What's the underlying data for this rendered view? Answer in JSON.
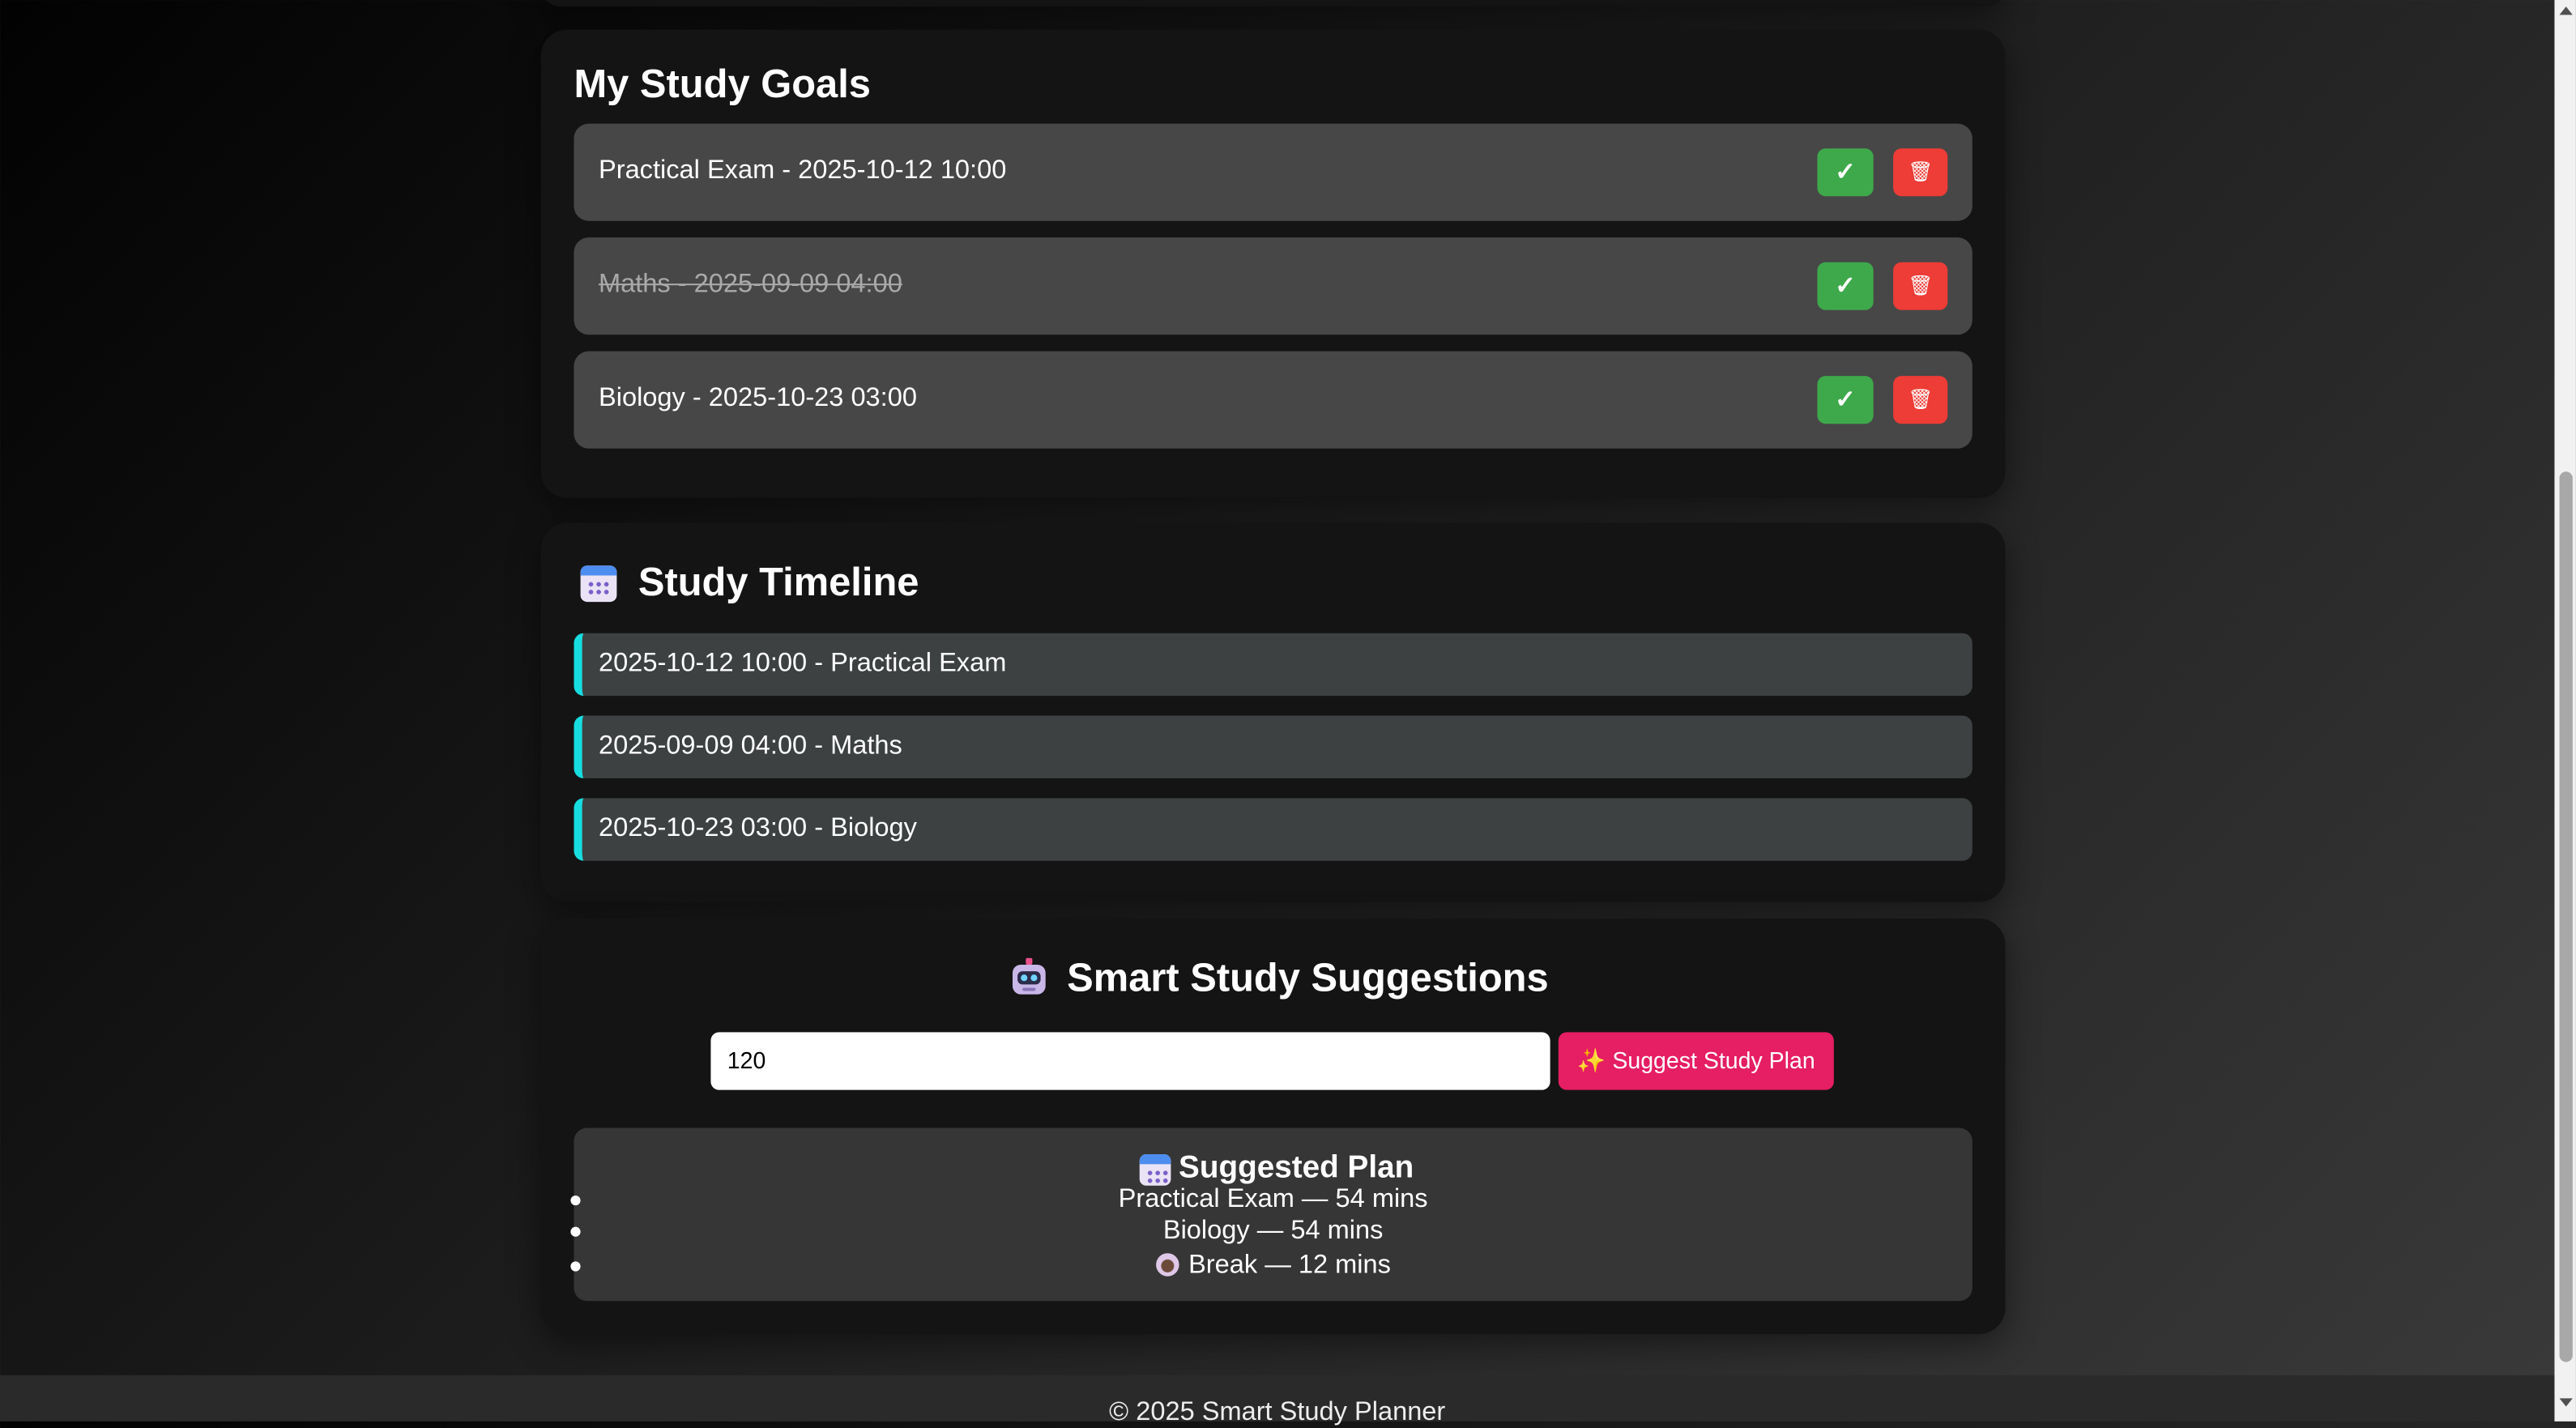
{
  "goals_section": {
    "title": "My Study Goals",
    "goals": [
      {
        "text": "Practical Exam - 2025-10-12 10:00",
        "completed": false
      },
      {
        "text": "Maths - 2025-09-09 04:00",
        "completed": true
      },
      {
        "text": "Biology - 2025-10-23 03:00",
        "completed": false
      }
    ],
    "done_button_label": "✓",
    "delete_button_label": "🗑"
  },
  "timeline_section": {
    "title": "Study Timeline",
    "icon": "calendar-icon",
    "items": [
      "2025-10-12 10:00 - Practical Exam",
      "2025-09-09 04:00 - Maths",
      "2025-10-23 03:00 - Biology"
    ],
    "accent_color": "#17dde0"
  },
  "suggestions_section": {
    "title": "Smart Study Suggestions",
    "icon": "robot-icon",
    "minutes_input_value": "120",
    "suggest_button_label": "✨ Suggest Study Plan",
    "plan": {
      "title": "Suggested Plan",
      "items": [
        "Practical Exam — 54 mins",
        "Biology — 54 mins",
        "Break — 12 mins"
      ]
    }
  },
  "footer": {
    "text": "© 2025 Smart Study Planner"
  },
  "colors": {
    "done_green": "#3ea94b",
    "delete_red": "#ee3c36",
    "suggest_pink": "#e61e63"
  }
}
